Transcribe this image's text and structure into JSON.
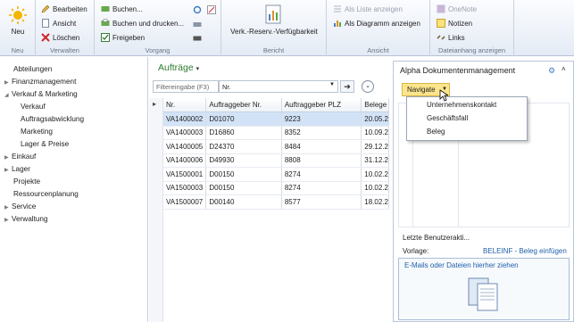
{
  "ribbon": {
    "new_label": "Neu",
    "groups": {
      "new": "Neu",
      "manage": "Verwalten",
      "process": "Vorgang",
      "report": "Bericht",
      "view": "Ansicht",
      "attachments": "Dateianhang anzeigen"
    },
    "edit": "Bearbeiten",
    "view": "Ansicht",
    "delete": "Löschen",
    "post": "Buchen...",
    "post_print": "Buchen und drucken...",
    "release": "Freigeben",
    "report_btn": "Verk.-Reserv.-Verfügbarkeit",
    "as_list": "Als Liste anzeigen",
    "as_chart": "Als Diagramm anzeigen",
    "onenote": "OneNote",
    "notes": "Notizen",
    "links": "Links"
  },
  "nav": {
    "items": [
      "Abteilungen",
      "Finanzmanagement",
      "Verkauf & Marketing",
      "Verkauf",
      "Auftragsabwicklung",
      "Marketing",
      "Lager & Preise",
      "Einkauf",
      "Lager",
      "Projekte",
      "Ressourcenplanung",
      "Service",
      "Verwaltung"
    ]
  },
  "main": {
    "title": "Aufträge",
    "filter_label": "Filtereingabe (F3)",
    "filter_field": "Nr.",
    "columns": [
      "Nr.",
      "Auftraggeber Nr.",
      "Auftraggeber PLZ",
      "Belege"
    ],
    "rows": [
      [
        "VA1400002",
        "D01070",
        "9223",
        "20.05.2"
      ],
      [
        "VA1400003",
        "D16860",
        "8352",
        "10.09.2"
      ],
      [
        "VA1400005",
        "D24370",
        "8484",
        "29.12.2"
      ],
      [
        "VA1400006",
        "D49930",
        "8808",
        "31.12.2"
      ],
      [
        "VA1500001",
        "D00150",
        "8274",
        "10.02.2"
      ],
      [
        "VA1500003",
        "D00150",
        "8274",
        "10.02.2"
      ],
      [
        "VA1500007",
        "D00140",
        "8577",
        "18.02.2"
      ]
    ]
  },
  "panel": {
    "title": "Alpha Dokumentenmanagement",
    "navigate": "Navigate",
    "menu": [
      "Unternehmenskontakt",
      "Geschäftsfall",
      "Beleg"
    ],
    "recent": "Letzte Benutzerakti...",
    "template_label": "Vorlage:",
    "template_link": "BELEINF - Beleg einfügen",
    "drop_text": "E-Mails oder Dateien hierher ziehen"
  },
  "colors": {
    "accent": "#2e7d32",
    "link": "#1f5fa8",
    "navigate_bg": "#fde58c"
  }
}
